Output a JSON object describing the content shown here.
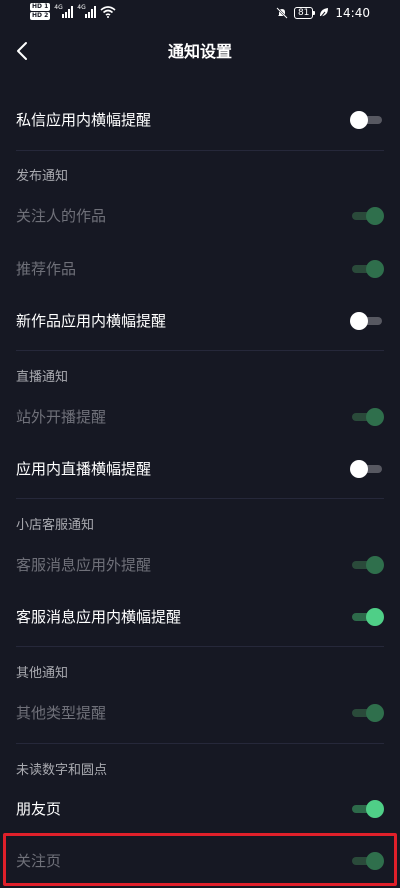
{
  "status_bar": {
    "hd1": "HD 1",
    "hd2": "HD 2",
    "net1": "4G",
    "net2": "4G",
    "battery": "81",
    "time": "14:40"
  },
  "header": {
    "title": "通知设置"
  },
  "rows": {
    "private_banner": {
      "label": "私信应用内横幅提醒",
      "state": "off"
    },
    "follow_works": {
      "label": "关注人的作品",
      "state": "on-disabled"
    },
    "recommended_works": {
      "label": "推荐作品",
      "state": "on-disabled"
    },
    "new_work_banner": {
      "label": "新作品应用内横幅提醒",
      "state": "off"
    },
    "offsite_live": {
      "label": "站外开播提醒",
      "state": "on-disabled"
    },
    "inapp_live_banner": {
      "label": "应用内直播横幅提醒",
      "state": "off"
    },
    "cs_offapp": {
      "label": "客服消息应用外提醒",
      "state": "on-disabled"
    },
    "cs_inapp_banner": {
      "label": "客服消息应用内横幅提醒",
      "state": "on"
    },
    "other_types": {
      "label": "其他类型提醒",
      "state": "on-disabled"
    },
    "friends_page": {
      "label": "朋友页",
      "state": "on"
    },
    "follow_page": {
      "label": "关注页",
      "state": "on-disabled"
    }
  },
  "sections": {
    "publish": "发布通知",
    "live": "直播通知",
    "shop_cs": "小店客服通知",
    "other": "其他通知",
    "unread": "未读数字和圆点"
  },
  "colors": {
    "background": "#161823",
    "toggle_on": "#4fcf87",
    "highlight": "#e0202a"
  }
}
